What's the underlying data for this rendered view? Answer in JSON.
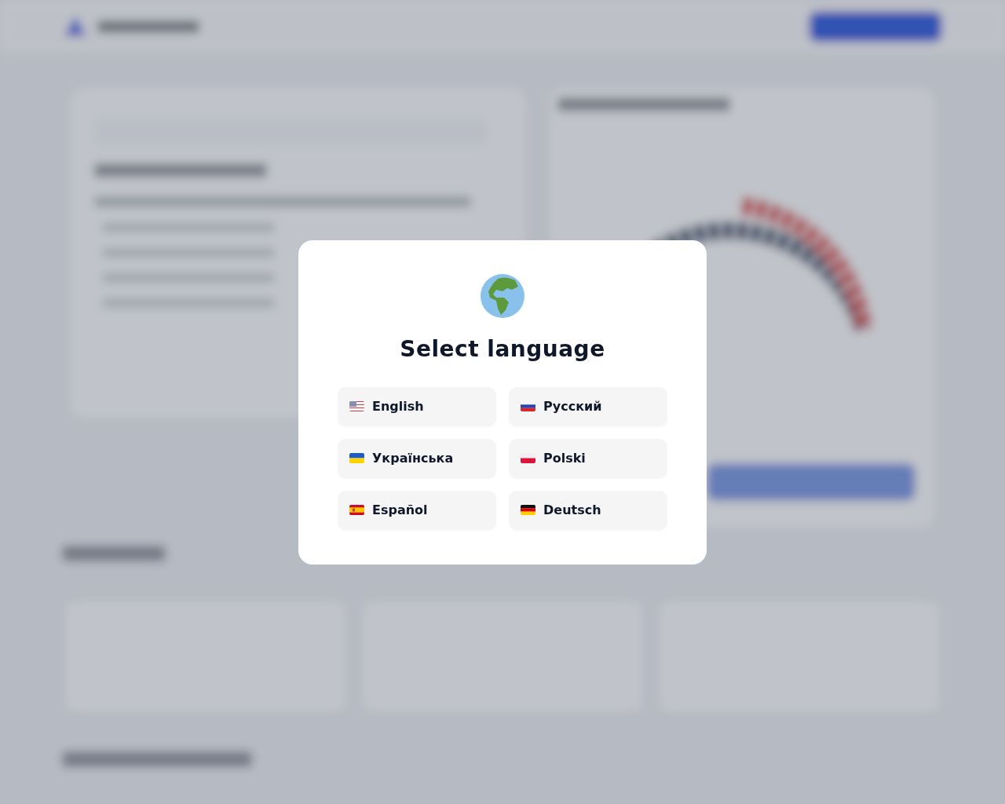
{
  "dialog": {
    "title": "Select language",
    "languages": [
      {
        "label": "English",
        "kind": "us"
      },
      {
        "label": "Русский",
        "kind": "ru"
      },
      {
        "label": "Українська",
        "kind": "ua"
      },
      {
        "label": "Polski",
        "kind": "pl"
      },
      {
        "label": "Español",
        "kind": "es"
      },
      {
        "label": "Deutsch",
        "kind": "de"
      }
    ]
  }
}
